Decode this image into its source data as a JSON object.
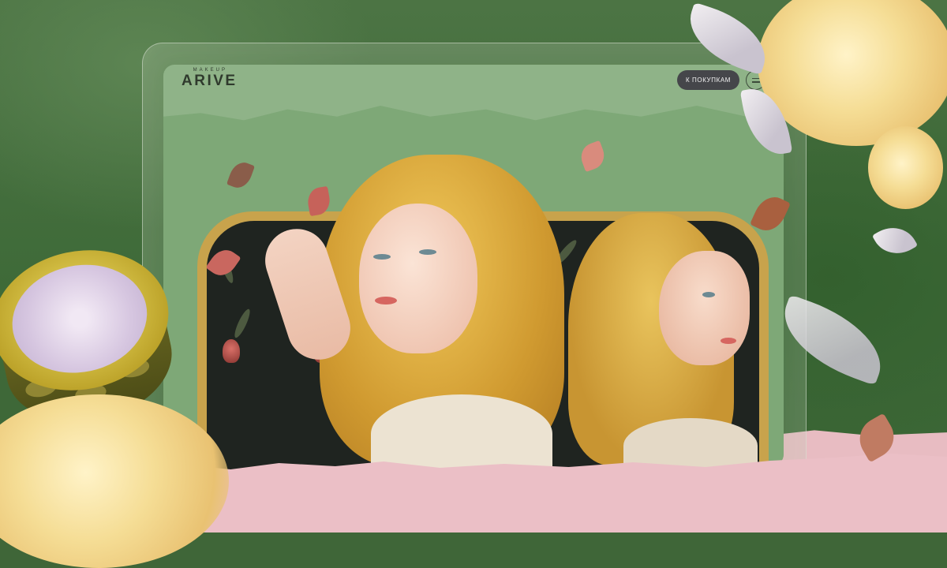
{
  "header": {
    "brand_tagline": "MAKEUP",
    "brand_name": "ARIVE",
    "shop_button_label": "К ПОКУПКАМ",
    "menu_icon": "hamburger-menu-icon"
  },
  "colors": {
    "background_green": "#3f6638",
    "screen_green": "#8fb388",
    "pink_paper": "#ebbfc6",
    "button_dark": "#45464a",
    "gold_frame": "#c8a34c"
  },
  "illustration": {
    "elements": [
      "portrait-woman-front",
      "portrait-woman-profile",
      "golden-compact-case",
      "yellow-roses",
      "silver-leaves",
      "falling-petals"
    ]
  }
}
